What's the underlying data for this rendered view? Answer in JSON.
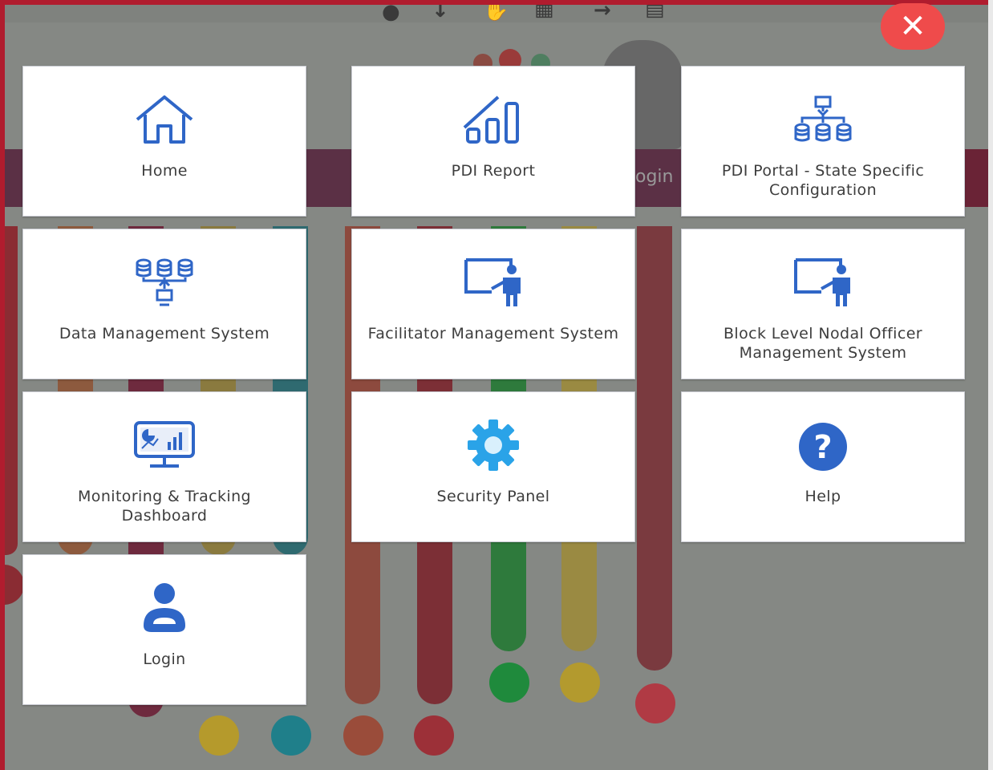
{
  "colors": {
    "accent": "#2f66c7",
    "close_button": "#ef4b4b",
    "frame_border": "#b01c2e",
    "backdrop": "#858884"
  },
  "close_button": {
    "label": "✕",
    "icon": "close-icon"
  },
  "background_text": {
    "login_fragment": "ogin"
  },
  "menu": {
    "items": [
      {
        "label": "Home",
        "icon": "home-icon"
      },
      {
        "label": "PDI Report",
        "icon": "bar-chart-icon"
      },
      {
        "label": "PDI Portal - State Specific Configuration",
        "icon": "network-databases-icon"
      },
      {
        "label": "Data Management System",
        "icon": "databases-computer-icon"
      },
      {
        "label": "Facilitator Management System",
        "icon": "presenter-board-icon"
      },
      {
        "label": "Block Level Nodal Officer Management System",
        "icon": "presenter-board-icon"
      },
      {
        "label": "Monitoring & Tracking Dashboard",
        "icon": "monitor-dashboard-icon"
      },
      {
        "label": "Security Panel",
        "icon": "gear-icon"
      },
      {
        "label": "Help",
        "icon": "help-icon"
      },
      {
        "label": "Login",
        "icon": "user-icon"
      }
    ]
  }
}
